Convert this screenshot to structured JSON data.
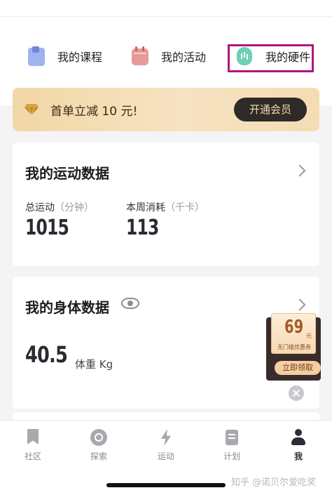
{
  "quick_links": {
    "course_label": "我的课程",
    "activity_label": "我的活动",
    "hardware_label": "我的硬件"
  },
  "vip_banner": {
    "text": "首单立减 10 元!",
    "button_label": "开通会员"
  },
  "sport_data": {
    "title": "我的运动数据",
    "total_label": "总运动",
    "total_unit": "（分钟）",
    "total_value": "1015",
    "week_label": "本周消耗",
    "week_unit": "（千卡）",
    "week_value": "113"
  },
  "body_data": {
    "title": "我的身体数据",
    "weight_value": "40.5",
    "weight_unit": "体重 Kg"
  },
  "coupon": {
    "amount": "69",
    "currency": "元",
    "description": "无门槛优惠券",
    "button_label": "立即领取"
  },
  "tab_bar": {
    "tabs": [
      {
        "label": "社区",
        "icon": "bookmark-icon"
      },
      {
        "label": "探索",
        "icon": "explore-icon"
      },
      {
        "label": "运动",
        "icon": "bolt-icon"
      },
      {
        "label": "计划",
        "icon": "plan-icon"
      },
      {
        "label": "我",
        "icon": "profile-icon"
      }
    ],
    "active_index": 4
  },
  "watermark": "知乎 @诺贝尔爱吃奖",
  "colors": {
    "highlight_box": "#b0177a",
    "vip_gradient_start": "#f2d7a6",
    "vip_button": "#2d2a28",
    "active_tab": "#2c2c3a"
  }
}
